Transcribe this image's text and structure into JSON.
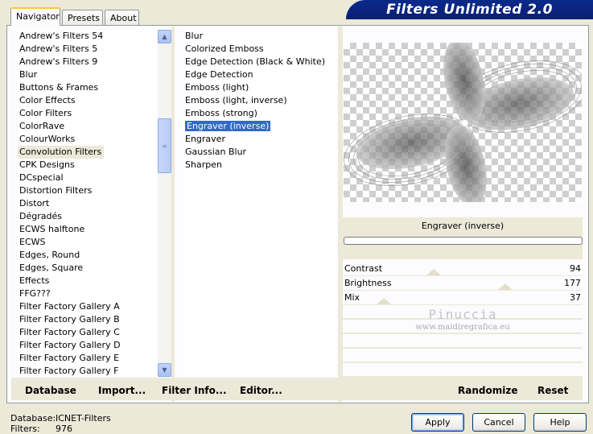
{
  "tabs": [
    {
      "label": "Navigator",
      "active": true
    },
    {
      "label": "Presets",
      "active": false
    },
    {
      "label": "About",
      "active": false
    }
  ],
  "title_banner": "Filters Unlimited 2.0",
  "categories": [
    "Andrew's Filters 54",
    "Andrew's Filters 5",
    "Andrew's Filters 9",
    "Blur",
    "Buttons & Frames",
    "Color Effects",
    "Color Filters",
    "ColorRave",
    "ColourWorks",
    "Convolution Filters",
    "CPK Designs",
    "DCspecial",
    "Distortion Filters",
    "Distort",
    "Dégradés",
    "ECWS halftone",
    "ECWS",
    "Edges, Round",
    "Edges, Square",
    "Effects",
    "FFG???",
    "Filter Factory Gallery A",
    "Filter Factory Gallery B",
    "Filter Factory Gallery C",
    "Filter Factory Gallery D",
    "Filter Factory Gallery E",
    "Filter Factory Gallery F"
  ],
  "selected_category": "Convolution Filters",
  "filters": [
    "Blur",
    "Colorized Emboss",
    "Edge Detection (Black & White)",
    "Edge Detection",
    "Emboss (light)",
    "Emboss (light, inverse)",
    "Emboss (strong)",
    "Engraver (inverse)",
    "Engraver",
    "Gaussian Blur",
    "Sharpen"
  ],
  "selected_filter": "Engraver (inverse)",
  "preview": {
    "filter_name": "Engraver (inverse)"
  },
  "sliders": [
    {
      "label": "Contrast",
      "value": "94",
      "fraction": 0.37
    },
    {
      "label": "Brightness",
      "value": "177",
      "fraction": 0.69
    },
    {
      "label": "Mix",
      "value": "37",
      "fraction": 0.15
    }
  ],
  "watermark": {
    "line1": "Pinuccia",
    "line2": "www.maidiregrafica.eu"
  },
  "left_buttons": {
    "database": "Database",
    "import": "Import...",
    "filter_info": "Filter Info...",
    "editor": "Editor..."
  },
  "right_buttons": {
    "randomize": "Randomize",
    "reset": "Reset"
  },
  "status": {
    "database_label": "Database:",
    "database_value": "ICNET-Filters",
    "filters_label": "Filters:",
    "filters_value": "976"
  },
  "dialog_buttons": {
    "apply": "Apply",
    "cancel": "Cancel",
    "help": "Help"
  }
}
